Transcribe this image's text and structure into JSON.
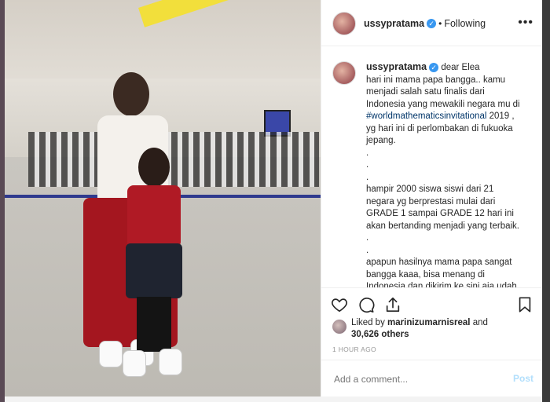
{
  "post": {
    "header": {
      "username": "ussypratama",
      "separator": "•",
      "follow_state": "Following",
      "more_icon": "more-horizontal-icon"
    },
    "caption": {
      "username": "ussypratama",
      "greeting": "dear Elea",
      "line1_a": "hari ini mama papa bangga.. kamu menjadi salah satu finalis dari Indonesia yang mewakili negara mu di ",
      "hashtag": "#worldmathematicsinvitational",
      "line1_b": " 2019 , yg hari ini di perlombakan di fukuoka jepang.",
      "dot1": ".",
      "dot2": ".",
      "dot3": ".",
      "para2": "hampir 2000 siswa siswi dari 21 negara yg berprestasi mulai dari GRADE 1 sampai GRADE 12 hari ini akan bertanding menjadi yang terbaik.",
      "dot4": ".",
      "dot5": ".",
      "para3": "apapun hasilnya mama papa sangat bangga kaaa, bisa menang di Indonesia dan dikirim ke sini aja udah"
    },
    "likes": {
      "prefix": "Liked by ",
      "user": "marinizumarnisreal",
      "suffix": " and",
      "others": "30,626 others"
    },
    "timestamp": "1 HOUR AGO",
    "comment_placeholder": "Add a comment...",
    "post_label": "Post"
  },
  "colors": {
    "verified": "#3897f0",
    "hashtag": "#003569",
    "post_disabled": "#b2dffc"
  }
}
